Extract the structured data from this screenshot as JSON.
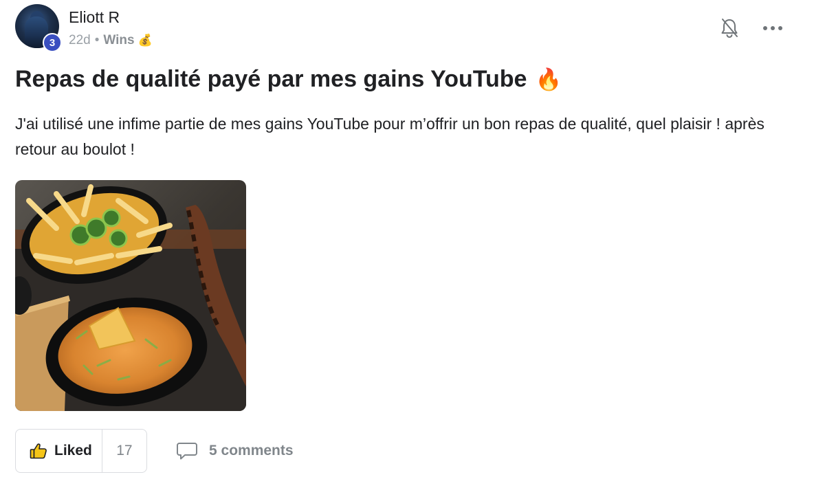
{
  "author": {
    "name": "Eliott R",
    "level": "3"
  },
  "meta": {
    "age": "22d",
    "separator": "•",
    "category": "Wins",
    "category_icon": "money-bag-icon"
  },
  "post": {
    "title": "Repas de qualité payé par mes gains YouTube",
    "title_icon": "fire-icon",
    "body": "J'ai utilisé une infime partie de mes gains YouTube pour m’offrir un bon repas de qualité, quel plaisir ! après retour au boulot !"
  },
  "actions": {
    "like_label": "Liked",
    "like_count": "17",
    "comments_label": "5 comments"
  },
  "icons": {
    "bell": "bell-off-icon",
    "more": "more-horizontal-icon",
    "like": "thumbs-up-icon",
    "comment": "comment-icon"
  },
  "colors": {
    "badge": "#3a4fc0",
    "text_primary": "#202124",
    "text_muted": "#80868b",
    "border": "#dadce0",
    "thumb_fill": "#f5c518"
  }
}
